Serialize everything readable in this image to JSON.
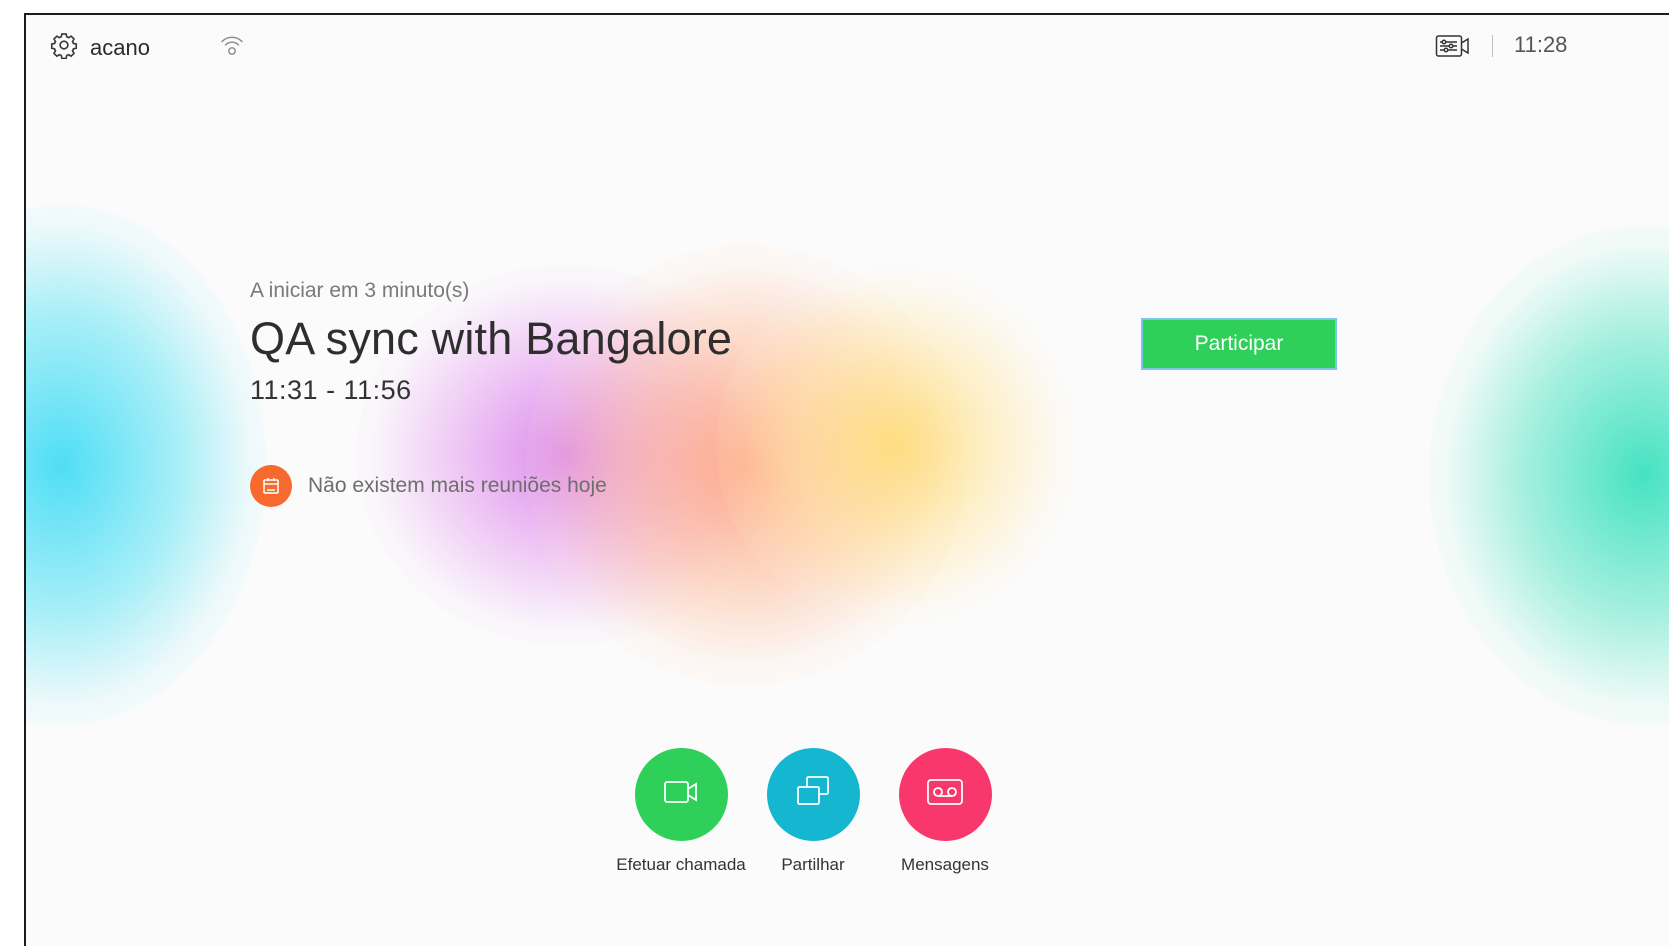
{
  "topbar": {
    "device_name": "acano",
    "clock": "11:28",
    "settings_icon": "gear-icon",
    "network_icon": "wifi-icon",
    "camera_control_icon": "camera-control-icon"
  },
  "meeting": {
    "starting_text": "A iniciar em 3 minuto(s)",
    "title": "QA sync with Bangalore",
    "time_range": "11:31 - 11:56",
    "join_label": "Participar",
    "join_color": "#2ed05a"
  },
  "no_more_meetings": {
    "text": "Não existem mais reuniões hoje",
    "icon": "calendar-icon",
    "icon_color": "#f66a2e"
  },
  "actions": [
    {
      "label": "Efetuar chamada",
      "icon": "video-camera-icon",
      "color": "#2ed05a"
    },
    {
      "label": "Partilhar",
      "icon": "share-screen-icon",
      "color": "#15b6cf"
    },
    {
      "label": "Mensagens",
      "icon": "voicemail-icon",
      "color": "#f8386c"
    }
  ]
}
